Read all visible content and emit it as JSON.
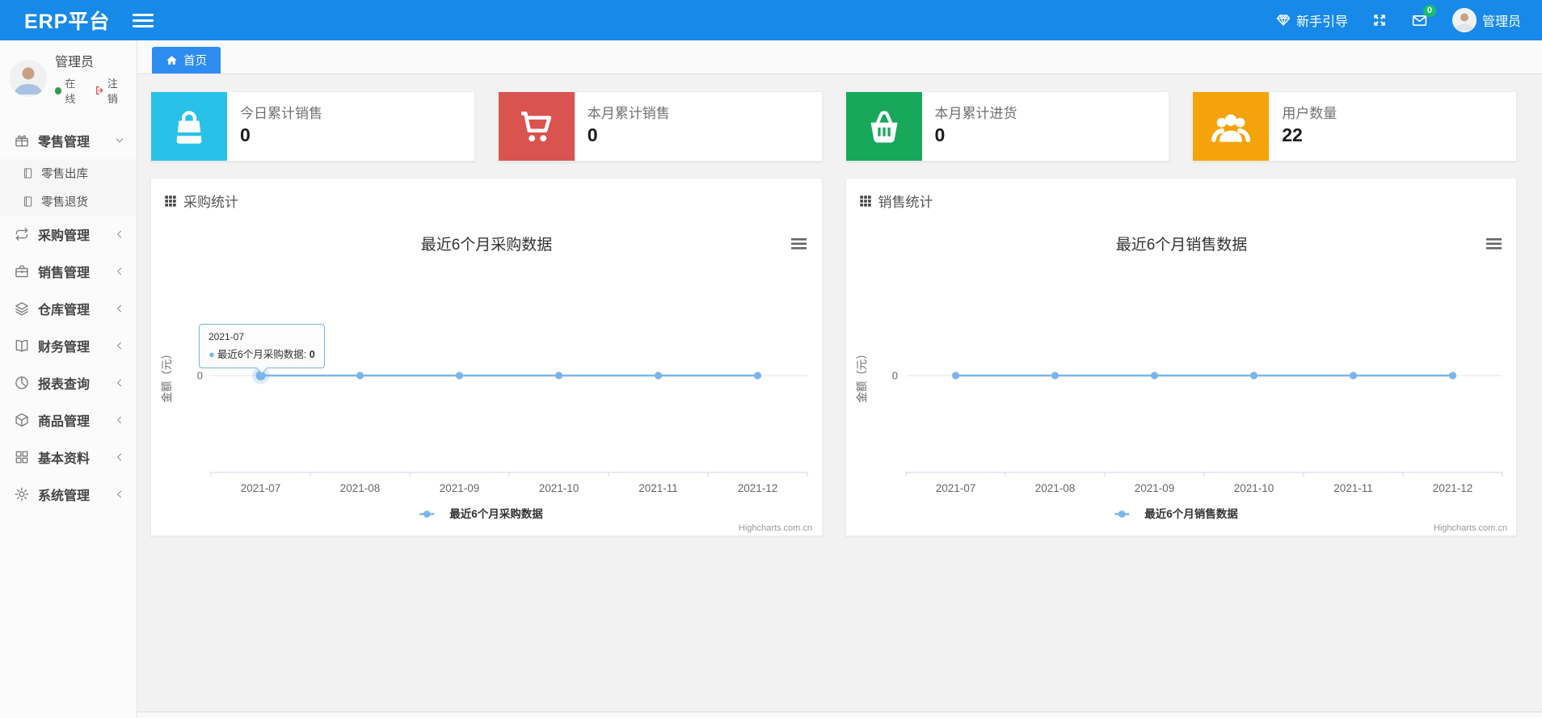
{
  "navbar": {
    "brand": "ERP平台",
    "guide_label": "新手引导",
    "mail_badge": "0",
    "username": "管理员",
    "accent_color": "#1789e8"
  },
  "sidebar": {
    "username": "管理员",
    "online_label": "在线",
    "logout_label": "注销",
    "menu": [
      {
        "key": "retail",
        "label": "零售管理",
        "icon": "gift-icon",
        "expanded": true,
        "children": [
          {
            "key": "retail-outbound",
            "label": "零售出库",
            "icon": "file-icon"
          },
          {
            "key": "retail-return",
            "label": "零售退货",
            "icon": "file-icon"
          }
        ]
      },
      {
        "key": "purchase",
        "label": "采购管理",
        "icon": "repeat-icon"
      },
      {
        "key": "sales",
        "label": "销售管理",
        "icon": "briefcase-icon"
      },
      {
        "key": "warehouse",
        "label": "仓库管理",
        "icon": "layers-icon"
      },
      {
        "key": "finance",
        "label": "财务管理",
        "icon": "book-icon"
      },
      {
        "key": "reports",
        "label": "报表查询",
        "icon": "pie-chart-icon"
      },
      {
        "key": "goods",
        "label": "商品管理",
        "icon": "cube-icon"
      },
      {
        "key": "basic",
        "label": "基本资料",
        "icon": "grid-icon"
      },
      {
        "key": "system",
        "label": "系统管理",
        "icon": "gear-icon"
      }
    ]
  },
  "tabs": [
    {
      "key": "home",
      "label": "首页",
      "icon": "home-icon",
      "active": true
    }
  ],
  "stat_cards": [
    {
      "key": "today-sales",
      "label": "今日累计销售",
      "value": "0",
      "icon": "bag-icon",
      "color": "#29c1e8"
    },
    {
      "key": "month-sales",
      "label": "本月累计销售",
      "value": "0",
      "icon": "cart-icon",
      "color": "#d9534f"
    },
    {
      "key": "month-purchase",
      "label": "本月累计进货",
      "value": "0",
      "icon": "basket-icon",
      "color": "#18a85c"
    },
    {
      "key": "user-count",
      "label": "用户数量",
      "value": "22",
      "icon": "users-icon",
      "color": "#f5a30a"
    }
  ],
  "panels": [
    {
      "key": "purchase-stats",
      "title": "采购统计"
    },
    {
      "key": "sales-stats",
      "title": "销售统计"
    }
  ],
  "chart_data": [
    {
      "type": "line",
      "title": "最近6个月采购数据",
      "categories": [
        "2021-07",
        "2021-08",
        "2021-09",
        "2021-10",
        "2021-11",
        "2021-12"
      ],
      "series": [
        {
          "name": "最近6个月采购数据",
          "values": [
            0,
            0,
            0,
            0,
            0,
            0
          ],
          "color": "#7cb5ec"
        }
      ],
      "xlabel": "",
      "ylabel": "金额（元）",
      "y_tick_label": "0",
      "ylim": [
        -1,
        1
      ],
      "grid": true,
      "legend_position": "bottom",
      "credit": "Highcharts.com.cn",
      "tooltip": {
        "header": "2021-07",
        "series": "最近6个月采购数据",
        "value": "0",
        "point_index": 0
      }
    },
    {
      "type": "line",
      "title": "最近6个月销售数据",
      "categories": [
        "2021-07",
        "2021-08",
        "2021-09",
        "2021-10",
        "2021-11",
        "2021-12"
      ],
      "series": [
        {
          "name": "最近6个月销售数据",
          "values": [
            0,
            0,
            0,
            0,
            0,
            0
          ],
          "color": "#7cb5ec"
        }
      ],
      "xlabel": "",
      "ylabel": "金额（元）",
      "y_tick_label": "0",
      "ylim": [
        -1,
        1
      ],
      "grid": true,
      "legend_position": "bottom",
      "credit": "Highcharts.com.cn"
    }
  ]
}
